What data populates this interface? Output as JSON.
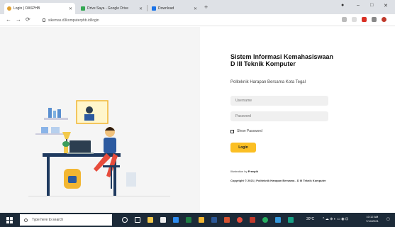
{
  "browser": {
    "tabs": [
      {
        "label": "Login | OASPHB",
        "favicon_color": "#e0a030"
      },
      {
        "label": "Drive Saya - Google Drive",
        "favicon_color": "#34a853"
      },
      {
        "label": "Download",
        "favicon_color": "#1a73e8"
      }
    ],
    "new_tab": "+",
    "url": "sikemas.d3komputerphb.id/login",
    "window_controls": {
      "minimize": "–",
      "maximize": "□",
      "close": "✕"
    }
  },
  "login": {
    "title": "Sistem Informasi Kemahasiswaan D III Teknik Komputer",
    "subtitle": "Politeknik Harapan Bersama Kota Tegal",
    "username_placeholder": "Username",
    "password_placeholder": "Password",
    "show_password_label": "Show Password",
    "login_button": "Login",
    "credit_prefix": "Illustration by",
    "credit_name": "Freepik",
    "copyright": "Copyright © 2021 | Politeknik Harapan Bersama - D III Teknik Komputer"
  },
  "taskbar": {
    "search_placeholder": "Type here to search",
    "tray_temp": "30°C",
    "time": "10:12 AM",
    "date": "7/14/2021"
  },
  "colors": {
    "login_button": "#fbbf24",
    "taskbar": "#1c2a38",
    "tabbar": "#dee1e6"
  }
}
